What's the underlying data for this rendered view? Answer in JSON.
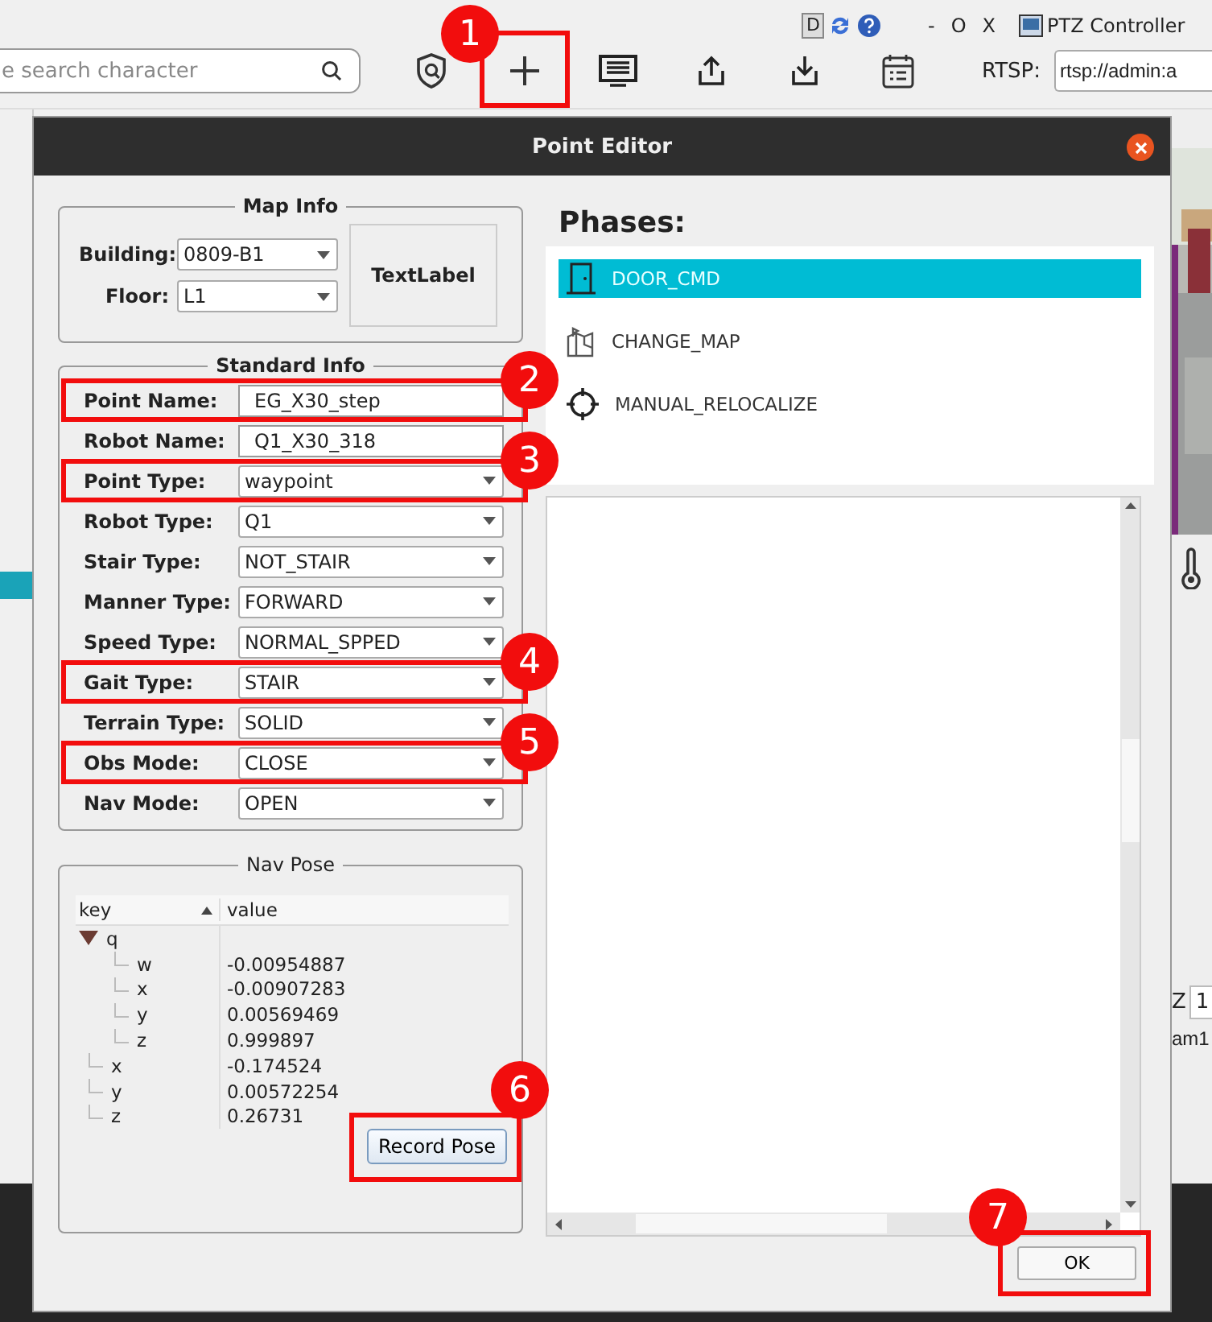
{
  "app": {
    "search": {
      "placeholder": "e search character"
    },
    "status_icons": [
      {
        "kind": "letter",
        "text": "D"
      },
      {
        "kind": "refresh"
      },
      {
        "kind": "help"
      }
    ],
    "window_controls": [
      "-",
      "O",
      "X"
    ],
    "ptz_title": "PTZ Controller",
    "toolbar": [
      {
        "kind": "shield"
      },
      {
        "kind": "add",
        "callout": "1"
      },
      {
        "kind": "monitor"
      },
      {
        "kind": "upload"
      },
      {
        "kind": "download"
      },
      {
        "kind": "calendar"
      }
    ],
    "rtsp_label": "RTSP:",
    "rtsp_value": "rtsp://admin:a",
    "side": {
      "z_label": "Z",
      "z_value": "1",
      "cam_text": "am1"
    }
  },
  "dialog": {
    "title": "Point Editor",
    "map_info": {
      "title": "Map Info",
      "building_label": "Building:",
      "building": "0809-B1",
      "floor_label": "Floor:",
      "floor": "L1",
      "text_label": "TextLabel"
    },
    "standard_info": {
      "title": "Standard Info",
      "fields": [
        {
          "label": "Point Name:",
          "value": "EG_X30_step",
          "kind": "text",
          "callout": "2"
        },
        {
          "label": "Robot Name:",
          "value": "Q1_X30_318",
          "kind": "text"
        },
        {
          "label": "Point Type:",
          "value": "waypoint",
          "kind": "combo",
          "callout": "3"
        },
        {
          "label": "Robot Type:",
          "value": "Q1",
          "kind": "combo"
        },
        {
          "label": "Stair Type:",
          "value": "NOT_STAIR",
          "kind": "combo"
        },
        {
          "label": "Manner Type:",
          "value": "FORWARD",
          "kind": "combo"
        },
        {
          "label": "Speed Type:",
          "value": "NORMAL_SPPED",
          "kind": "combo"
        },
        {
          "label": "Gait Type:",
          "value": "STAIR",
          "kind": "combo",
          "callout": "4"
        },
        {
          "label": "Terrain Type:",
          "value": "SOLID",
          "kind": "combo"
        },
        {
          "label": "Obs Mode:",
          "value": "CLOSE",
          "kind": "combo",
          "callout": "5"
        },
        {
          "label": "Nav Mode:",
          "value": "OPEN",
          "kind": "combo"
        }
      ]
    },
    "nav_pose": {
      "title": "Nav Pose",
      "columns": [
        "key",
        "value"
      ],
      "rows": [
        {
          "key": "q",
          "expanded": true,
          "children": [
            {
              "key": "w",
              "value": "-0.00954887"
            },
            {
              "key": "x",
              "value": "-0.00907283"
            },
            {
              "key": "y",
              "value": "0.00569469"
            },
            {
              "key": "z",
              "value": "0.999897"
            }
          ]
        },
        {
          "key": "x",
          "value": "-0.174524"
        },
        {
          "key": "y",
          "value": "0.00572254"
        },
        {
          "key": "z",
          "value": "0.26731"
        }
      ],
      "record_button": {
        "label": "Record Pose",
        "callout": "6"
      }
    },
    "phases": {
      "title": "Phases:",
      "items": [
        {
          "kind": "door",
          "label": "DOOR_CMD",
          "selected": true
        },
        {
          "kind": "map",
          "label": "CHANGE_MAP",
          "selected": false
        },
        {
          "kind": "crosshair",
          "label": "MANUAL_RELOCALIZE",
          "selected": false
        }
      ]
    },
    "ok_button": {
      "label": "OK",
      "callout": "7"
    }
  }
}
